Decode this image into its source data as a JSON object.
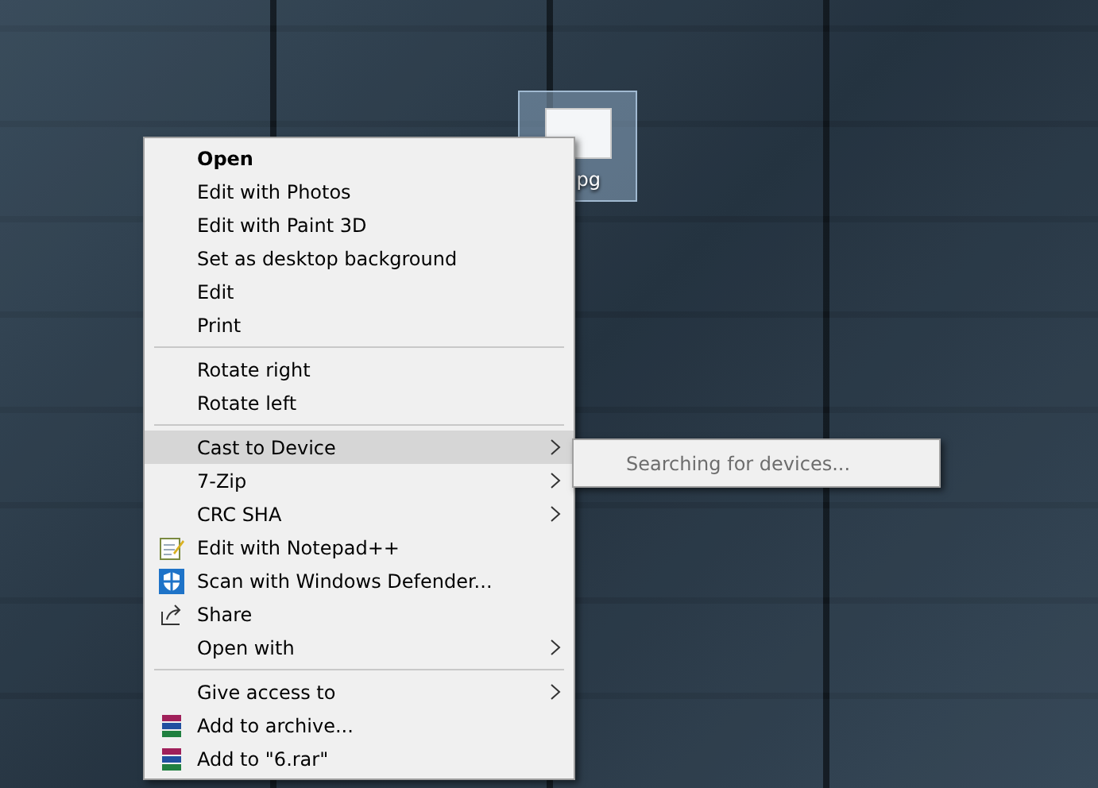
{
  "desktop_icon": {
    "label": "pg",
    "selected": true
  },
  "context_menu": {
    "groups": [
      {
        "items": [
          {
            "label": "Open",
            "default": true,
            "kind": "plain",
            "submenu": false,
            "selected": false
          },
          {
            "label": "Edit with Photos",
            "default": false,
            "kind": "plain",
            "submenu": false,
            "selected": false
          },
          {
            "label": "Edit with Paint 3D",
            "default": false,
            "kind": "plain",
            "submenu": false,
            "selected": false
          },
          {
            "label": "Set as desktop background",
            "default": false,
            "kind": "plain",
            "submenu": false,
            "selected": false
          },
          {
            "label": "Edit",
            "default": false,
            "kind": "plain",
            "submenu": false,
            "selected": false
          },
          {
            "label": "Print",
            "default": false,
            "kind": "plain",
            "submenu": false,
            "selected": false
          }
        ]
      },
      {
        "items": [
          {
            "label": "Rotate right",
            "default": false,
            "kind": "plain",
            "submenu": false,
            "selected": false
          },
          {
            "label": "Rotate left",
            "default": false,
            "kind": "plain",
            "submenu": false,
            "selected": false
          }
        ]
      },
      {
        "items": [
          {
            "label": "Cast to Device",
            "default": false,
            "kind": "plain",
            "submenu": true,
            "selected": true
          },
          {
            "label": "7-Zip",
            "default": false,
            "kind": "plain",
            "submenu": true,
            "selected": false
          },
          {
            "label": "CRC SHA",
            "default": false,
            "kind": "plain",
            "submenu": true,
            "selected": false
          },
          {
            "label": "Edit with Notepad++",
            "default": false,
            "kind": "notepad",
            "submenu": false,
            "selected": false
          },
          {
            "label": "Scan with Windows Defender...",
            "default": false,
            "kind": "shield",
            "submenu": false,
            "selected": false
          },
          {
            "label": "Share",
            "default": false,
            "kind": "share",
            "submenu": false,
            "selected": false
          },
          {
            "label": "Open with",
            "default": false,
            "kind": "plain",
            "submenu": true,
            "selected": false
          }
        ]
      },
      {
        "items": [
          {
            "label": "Give access to",
            "default": false,
            "kind": "plain",
            "submenu": true,
            "selected": false
          },
          {
            "label": "Add to archive...",
            "default": false,
            "kind": "archive",
            "submenu": false,
            "selected": false
          },
          {
            "label": "Add to \"6.rar\"",
            "default": false,
            "kind": "archive",
            "submenu": false,
            "selected": false
          }
        ]
      }
    ]
  },
  "submenu": {
    "items": [
      {
        "label": "Searching for devices...",
        "disabled": true
      }
    ]
  }
}
